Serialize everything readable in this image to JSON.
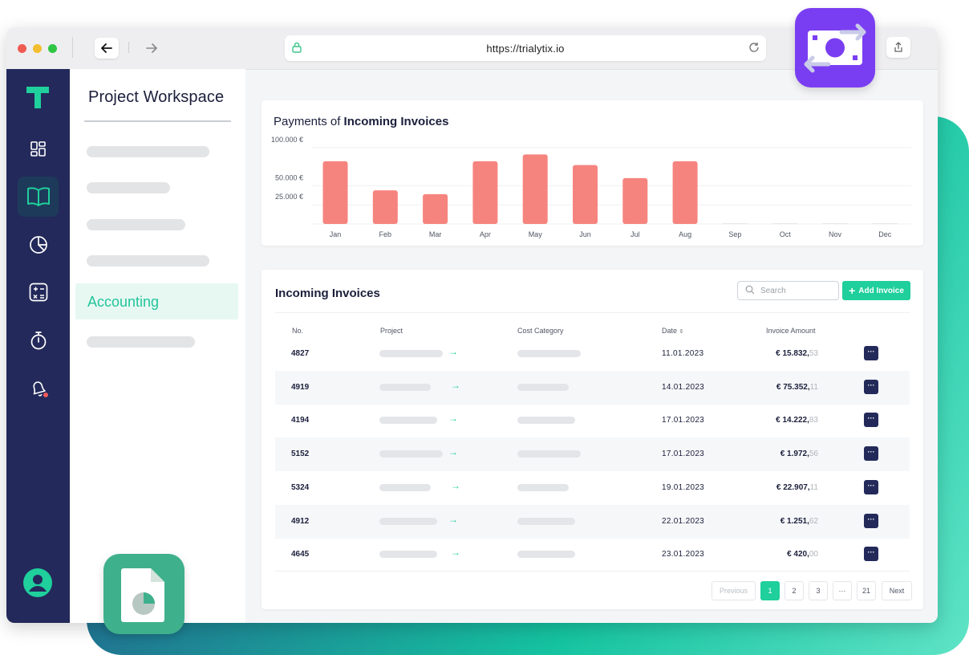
{
  "browser": {
    "url": "https://trialytix.io"
  },
  "sidebar": {
    "icons": [
      "dashboard-icon",
      "book-icon",
      "pie-chart-icon",
      "calculator-icon",
      "stopwatch-icon",
      "bell-icon"
    ],
    "active_icon": "book-icon"
  },
  "panel": {
    "title": "Project Workspace",
    "active_item": "Accounting"
  },
  "chart": {
    "title_prefix": "Payments of ",
    "title_bold": "Incoming Invoices"
  },
  "chart_data": {
    "type": "bar",
    "title": "Payments of Incoming Invoices",
    "categories": [
      "Jan",
      "Feb",
      "Mar",
      "Apr",
      "May",
      "Jun",
      "Jul",
      "Aug",
      "Sep",
      "Oct",
      "Nov",
      "Dec"
    ],
    "values": [
      82000,
      44000,
      39000,
      82000,
      91000,
      77000,
      60000,
      82000,
      0,
      0,
      0,
      0
    ],
    "y_tick_labels": [
      "100.000 €",
      "50.000 €",
      "25.000 €"
    ],
    "bar_color": "#f6847e",
    "grid": true
  },
  "invoices": {
    "title": "Incoming Invoices",
    "search_placeholder": "Search",
    "add_label": "Add Invoice",
    "columns": [
      "No.",
      "Project",
      "Cost Category",
      "Date",
      "Invoice Amount"
    ],
    "rows": [
      {
        "no": "4827",
        "date": "11.01.2023",
        "amount": "€ 15.832,",
        "cents": "53"
      },
      {
        "no": "4919",
        "date": "14.01.2023",
        "amount": "€ 75.352,",
        "cents": "11"
      },
      {
        "no": "4194",
        "date": "17.01.2023",
        "amount": "€ 14.222,",
        "cents": "83"
      },
      {
        "no": "5152",
        "date": "17.01.2023",
        "amount": "€ 1.972,",
        "cents": "56"
      },
      {
        "no": "5324",
        "date": "19.01.2023",
        "amount": "€ 22.907,",
        "cents": "11"
      },
      {
        "no": "4912",
        "date": "22.01.2023",
        "amount": "€ 1.251,",
        "cents": "62"
      },
      {
        "no": "4645",
        "date": "23.01.2023",
        "amount": "€ 420,",
        "cents": "00"
      }
    ],
    "pagination": {
      "previous": "Previous",
      "pages": [
        "1",
        "2",
        "3",
        "···",
        "21"
      ],
      "current": "1",
      "next": "Next"
    }
  },
  "colors": {
    "accent": "#1fcf9c",
    "sidebar": "#23295a",
    "bars": "#f6847e",
    "money_badge": "#7a3ef2",
    "doc_badge": "#3fb08c"
  }
}
